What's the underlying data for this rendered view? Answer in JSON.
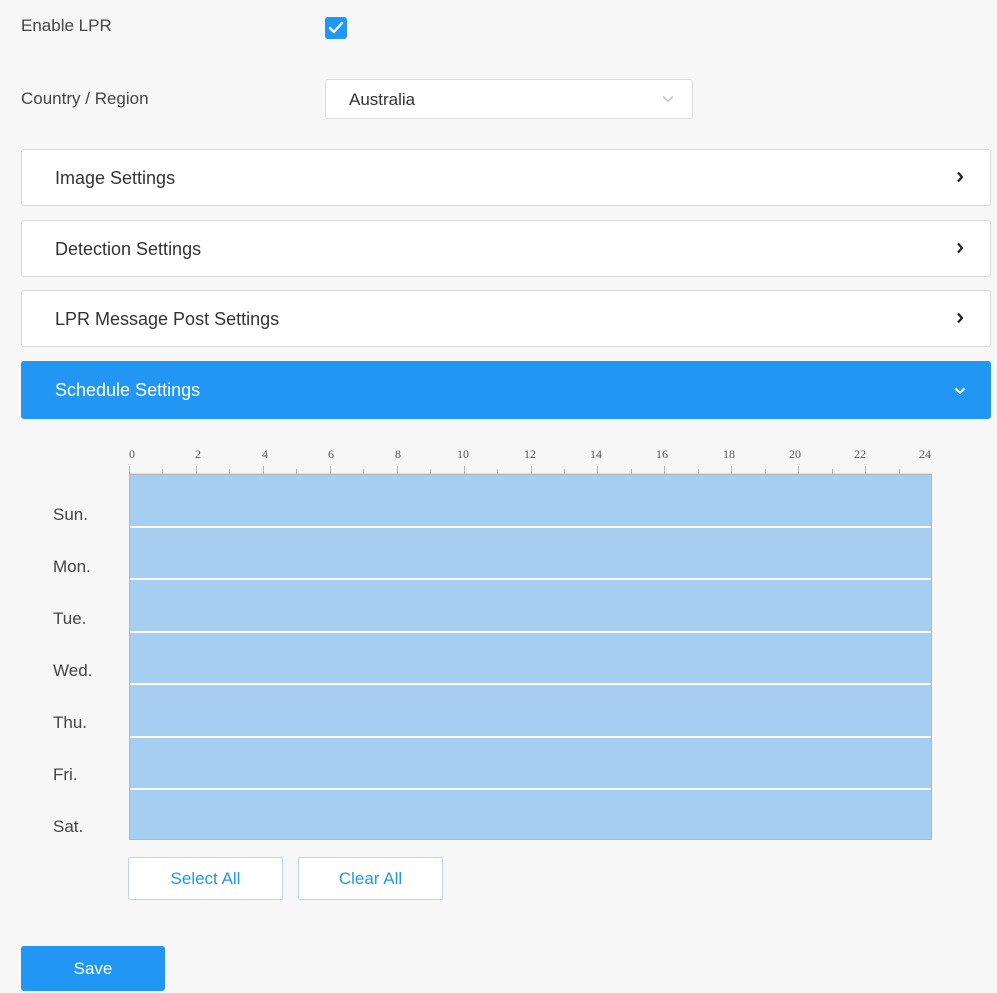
{
  "enable_lpr": {
    "label": "Enable LPR",
    "checked": true
  },
  "country_region": {
    "label": "Country / Region",
    "value": "Australia"
  },
  "panels": [
    {
      "title": "Image Settings",
      "expanded": false
    },
    {
      "title": "Detection Settings",
      "expanded": false
    },
    {
      "title": "LPR Message Post Settings",
      "expanded": false
    },
    {
      "title": "Schedule Settings",
      "expanded": true
    }
  ],
  "schedule": {
    "hour_labels": [
      "0",
      "2",
      "4",
      "6",
      "8",
      "10",
      "12",
      "14",
      "16",
      "18",
      "20",
      "22",
      "24"
    ],
    "days": [
      "Sun.",
      "Mon.",
      "Tue.",
      "Wed.",
      "Thu.",
      "Fri.",
      "Sat."
    ],
    "all_selected": true,
    "select_all_label": "Select All",
    "clear_all_label": "Clear All"
  },
  "save_label": "Save",
  "colors": {
    "accent": "#2196f3",
    "selected_cell": "#a5cef0"
  }
}
